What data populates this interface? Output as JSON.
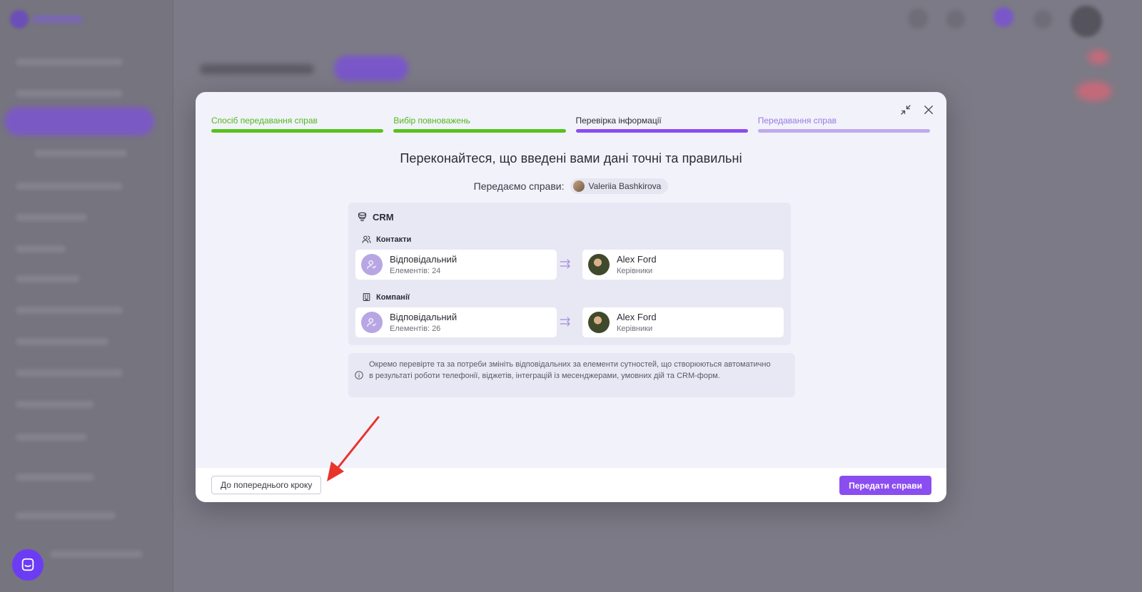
{
  "modal": {
    "steps": [
      {
        "label": "Спосіб передавання справ",
        "state": "done"
      },
      {
        "label": "Вибір повноважень",
        "state": "done"
      },
      {
        "label": "Перевірка інформації",
        "state": "current"
      },
      {
        "label": "Передавання справ",
        "state": "todo"
      }
    ],
    "heading": "Переконайтеся, що введені вами дані точні та правильні",
    "transfer_label": "Передаємо справи:",
    "transfer_user": "Valeriia Bashkirova",
    "crm": {
      "title": "CRM",
      "sections": [
        {
          "title": "Контакти",
          "icon": "users-icon",
          "from": {
            "title": "Відповідальний",
            "subtitle": "Елементів: 24"
          },
          "to": {
            "title": "Alex Ford",
            "subtitle": "Керівники"
          }
        },
        {
          "title": "Компанії",
          "icon": "building-icon",
          "from": {
            "title": "Відповідальний",
            "subtitle": "Елементів: 26"
          },
          "to": {
            "title": "Alex Ford",
            "subtitle": "Керівники"
          }
        }
      ]
    },
    "info_text": "Окремо перевірте та за потреби змініть відповідальних за елементи сутностей, що створюються автоматично в результаті роботи телефонії, віджетів, інтеграцій із месенджерами, умовних дій та CRM-форм.",
    "back_button": "До попереднього кроку",
    "submit_button": "Передати справи"
  },
  "colors": {
    "done": "#57c21c",
    "current": "#8a4df0",
    "todo": "#bfa9ee",
    "annotation": "#e8342b"
  }
}
